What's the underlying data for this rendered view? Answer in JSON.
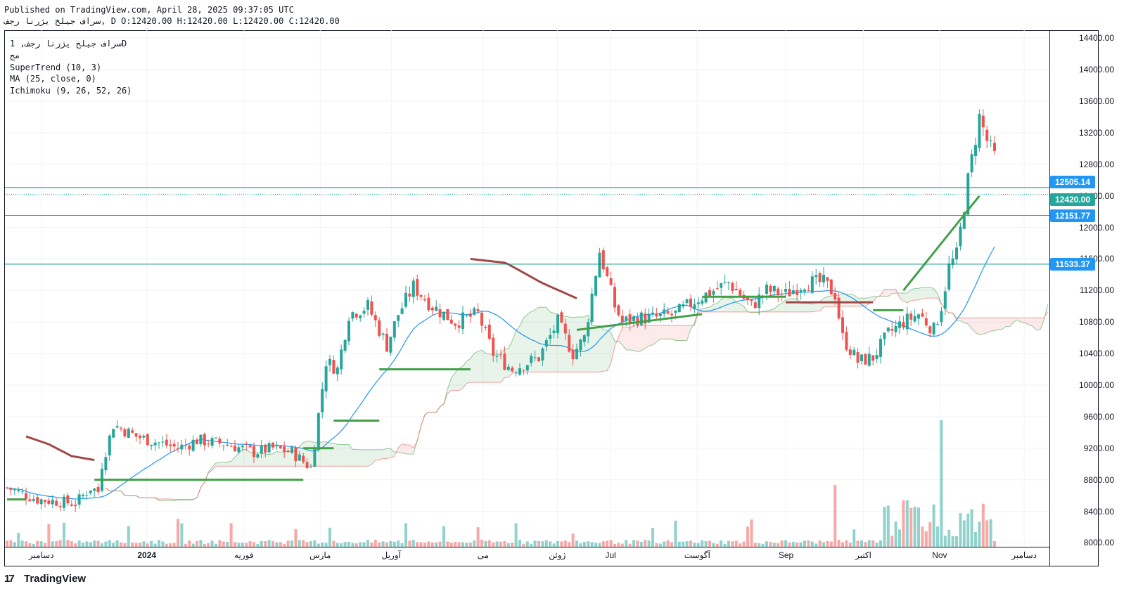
{
  "header": {
    "published": "Published on TradingView.com, April 28, 2025 09:37:05 UTC",
    "ohlc": "سراف جيلخ يژرنا رجف, D O:12420.00 H:12420.00 L:12420.00 C:12420.00"
  },
  "legend": {
    "symbol": "سراف جیلخ يژرنا رجف, 1D",
    "short": "مج",
    "supertrend": "SuperTrend (10, 3)",
    "ma": "MA (25, close, 0)",
    "ichimoku": "Ichimoku (9, 26, 52, 26)"
  },
  "brand": {
    "logo": "17",
    "name": "TradingView"
  },
  "colors": {
    "up": "#26a69a",
    "down": "#ef5350",
    "st_up": "#43a047",
    "st_down": "#a14848",
    "ma": "#2196f3",
    "hline": "#089981",
    "last": "#26a69a",
    "tag_blue": "#2196f3"
  },
  "chart_data": {
    "type": "candlestick",
    "ylim": [
      7950,
      14500
    ],
    "y_ticks": [
      "14400.00",
      "14000.00",
      "13600.00",
      "13200.00",
      "12800.00",
      "12400.00",
      "12000.00",
      "11600.00",
      "11200.00",
      "10800.00",
      "10400.00",
      "10000.00",
      "9600.00",
      "9200.00",
      "8800.00",
      "8400.00",
      "8000.00"
    ],
    "x_ticks": [
      "دسامبر",
      "2024",
      "فوریه",
      "مارس",
      "آوریل",
      "می",
      "ژوئن",
      "Jul",
      "آگوست",
      "Sep",
      "اکتبر",
      "Nov",
      "دسامبر"
    ],
    "price_tags": [
      {
        "value": "12505.14",
        "y": 12505.14,
        "color": "tag_blue"
      },
      {
        "value": "12420.00",
        "y": 12420,
        "color": "last"
      },
      {
        "value": "12151.77",
        "y": 12151.77,
        "color": "tag_blue"
      },
      {
        "value": "11533.37",
        "y": 11533.37,
        "color": "tag_blue"
      }
    ],
    "price_anchors": [
      [
        0,
        8700
      ],
      [
        8,
        8550
      ],
      [
        18,
        8500
      ],
      [
        22,
        8700
      ],
      [
        24,
        8650
      ],
      [
        25,
        9000
      ],
      [
        28,
        9500
      ],
      [
        34,
        9350
      ],
      [
        45,
        9200
      ],
      [
        50,
        9300
      ],
      [
        58,
        9250
      ],
      [
        65,
        9150
      ],
      [
        70,
        9200
      ],
      [
        75,
        9150
      ],
      [
        80,
        8950
      ],
      [
        84,
        10300
      ],
      [
        87,
        10200
      ],
      [
        90,
        10900
      ],
      [
        95,
        11000
      ],
      [
        100,
        10500
      ],
      [
        103,
        10900
      ],
      [
        107,
        11250
      ],
      [
        112,
        11000
      ],
      [
        118,
        10800
      ],
      [
        124,
        10900
      ],
      [
        128,
        10400
      ],
      [
        133,
        10200
      ],
      [
        140,
        10350
      ],
      [
        145,
        10800
      ],
      [
        149,
        10400
      ],
      [
        152,
        10600
      ],
      [
        156,
        11700
      ],
      [
        160,
        11000
      ],
      [
        162,
        10800
      ],
      [
        166,
        10850
      ],
      [
        170,
        10850
      ],
      [
        176,
        10900
      ],
      [
        182,
        11100
      ],
      [
        190,
        11300
      ],
      [
        196,
        11000
      ],
      [
        200,
        11200
      ],
      [
        205,
        11150
      ],
      [
        210,
        11300
      ],
      [
        215,
        11300
      ],
      [
        218,
        11150
      ],
      [
        220,
        10600
      ],
      [
        224,
        10300
      ],
      [
        228,
        10350
      ],
      [
        232,
        10650
      ],
      [
        236,
        10800
      ],
      [
        240,
        10900
      ],
      [
        244,
        10700
      ],
      [
        246,
        11000
      ],
      [
        248,
        11500
      ],
      [
        250,
        11650
      ],
      [
        253,
        12600
      ],
      [
        256,
        13400
      ],
      [
        258,
        13100
      ],
      [
        260,
        12900
      ]
    ],
    "n_bars": 261,
    "supertrend": [
      {
        "start": 0,
        "end": 5,
        "dir": "up",
        "v": [
          8550
        ]
      },
      {
        "start": 5,
        "end": 23,
        "dir": "down",
        "v": [
          9350,
          9250,
          9100,
          9050
        ]
      },
      {
        "start": 23,
        "end": 78,
        "dir": "up",
        "v": [
          8800
        ]
      },
      {
        "start": 78,
        "end": 86,
        "dir": "up",
        "v": [
          9200
        ]
      },
      {
        "start": 86,
        "end": 98,
        "dir": "up",
        "v": [
          9550
        ]
      },
      {
        "start": 98,
        "end": 122,
        "dir": "up",
        "v": [
          10200
        ]
      },
      {
        "start": 122,
        "end": 150,
        "dir": "down",
        "v": [
          11600,
          11550,
          11300,
          11100
        ]
      },
      {
        "start": 150,
        "end": 183,
        "dir": "up",
        "v": [
          10700,
          10900
        ]
      },
      {
        "start": 183,
        "end": 205,
        "dir": "up",
        "v": [
          11120
        ]
      },
      {
        "start": 205,
        "end": 228,
        "dir": "down",
        "v": [
          11050
        ]
      },
      {
        "start": 228,
        "end": 236,
        "dir": "up",
        "v": [
          10950
        ]
      },
      {
        "start": 236,
        "end": 256,
        "dir": "up",
        "v": [
          11200,
          12400
        ]
      }
    ]
  }
}
